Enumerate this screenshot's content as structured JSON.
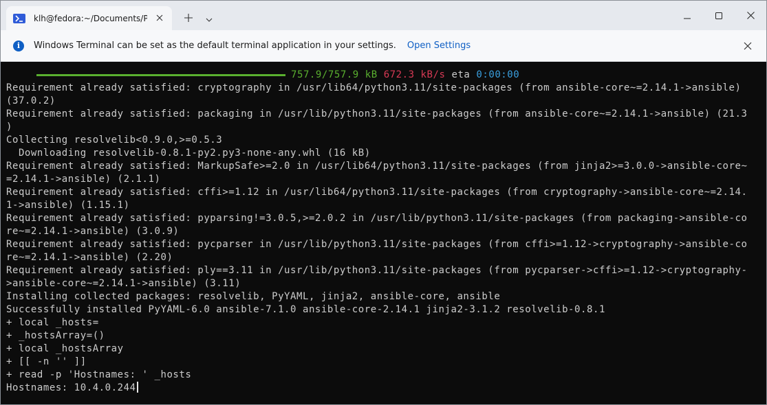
{
  "window": {
    "tab_title": "klh@fedora:~/Documents/PI-",
    "icons": {
      "tab_icon": "powershell-icon",
      "close_tab": "close-icon",
      "new_tab": "plus-icon",
      "dropdown": "chevron-down-icon",
      "minimize": "minimize-icon",
      "maximize": "maximize-icon",
      "close_window": "close-icon"
    }
  },
  "infobar": {
    "message": "Windows Terminal can be set as the default terminal application in your settings.",
    "link": "Open Settings",
    "icon": "info-icon"
  },
  "terminal": {
    "progress": {
      "fraction": 1.0,
      "size": "757.9/757.9 kB",
      "speed": "672.3 kB/s",
      "eta_label": "eta",
      "eta": "0:00:00"
    },
    "lines": [
      "Requirement already satisfied: cryptography in /usr/lib64/python3.11/site-packages (from ansible-core~=2.14.1->ansible)",
      "(37.0.2)",
      "Requirement already satisfied: packaging in /usr/lib/python3.11/site-packages (from ansible-core~=2.14.1->ansible) (21.3",
      ")",
      "Collecting resolvelib<0.9.0,>=0.5.3",
      "  Downloading resolvelib-0.8.1-py2.py3-none-any.whl (16 kB)",
      "Requirement already satisfied: MarkupSafe>=2.0 in /usr/lib64/python3.11/site-packages (from jinja2>=3.0.0->ansible-core~",
      "=2.14.1->ansible) (2.1.1)",
      "Requirement already satisfied: cffi>=1.12 in /usr/lib64/python3.11/site-packages (from cryptography->ansible-core~=2.14.",
      "1->ansible) (1.15.1)",
      "Requirement already satisfied: pyparsing!=3.0.5,>=2.0.2 in /usr/lib/python3.11/site-packages (from packaging->ansible-co",
      "re~=2.14.1->ansible) (3.0.9)",
      "Requirement already satisfied: pycparser in /usr/lib/python3.11/site-packages (from cffi>=1.12->cryptography->ansible-co",
      "re~=2.14.1->ansible) (2.20)",
      "Requirement already satisfied: ply==3.11 in /usr/lib/python3.11/site-packages (from pycparser->cffi>=1.12->cryptography-",
      ">ansible-core~=2.14.1->ansible) (3.11)",
      "Installing collected packages: resolvelib, PyYAML, jinja2, ansible-core, ansible",
      "Successfully installed PyYAML-6.0 ansible-7.1.0 ansible-core-2.14.1 jinja2-3.1.2 resolvelib-0.8.1",
      "+ local _hosts=",
      "+ _hostsArray=()",
      "+ local _hostsArray",
      "+ [[ -n '' ]]",
      "+ read -p 'Hostnames: ' _hosts"
    ],
    "prompt_line": "Hostnames: 10.4.0.244"
  }
}
